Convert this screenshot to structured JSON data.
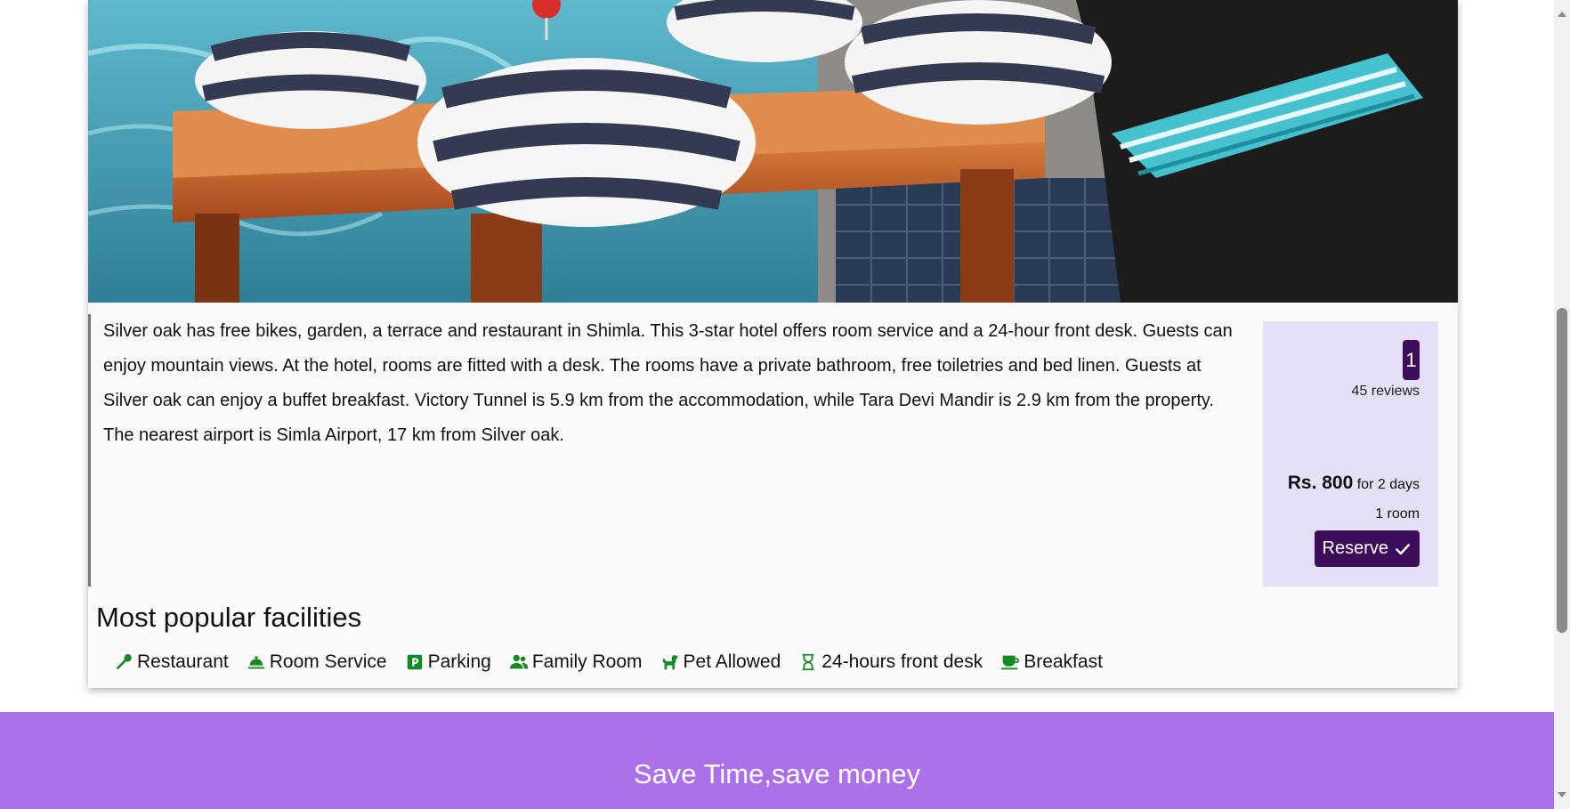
{
  "hotel": {
    "description": "Silver oak has free bikes, garden, a terrace and restaurant in Shimla. This 3-star hotel offers room service and a 24-hour front desk. Guests can enjoy mountain views. At the hotel, rooms are fitted with a desk. The rooms have a private bathroom, free toiletries and bed linen. Guests at Silver oak can enjoy a buffet breakfast. Victory Tunnel is 5.9 km from the accommodation, while Tara Devi Mandir is 2.9 km from the property. The nearest airport is Simla Airport, 17 km from Silver oak.",
    "score": "1",
    "reviews": "45 reviews",
    "price": "Rs. 800",
    "price_period": "for 2 days",
    "rooms": "1 room",
    "reserve_label": "Reserve"
  },
  "facilities": {
    "title": "Most popular facilities",
    "items": [
      {
        "label": "Restaurant",
        "icon": "utensil-icon"
      },
      {
        "label": "Room Service",
        "icon": "service-bell-icon"
      },
      {
        "label": "Parking",
        "icon": "parking-icon"
      },
      {
        "label": "Family Room",
        "icon": "users-icon"
      },
      {
        "label": "Pet Allowed",
        "icon": "dog-icon"
      },
      {
        "label": "24-hours front desk",
        "icon": "hourglass-icon"
      },
      {
        "label": "Breakfast",
        "icon": "coffee-icon"
      }
    ]
  },
  "footer": {
    "title": "Save Time,save money"
  },
  "colors": {
    "accent": "#3d0d5c",
    "side_panel": "#e5e0f7",
    "facility_icon": "#138a22",
    "footer_band": "#ac71e8"
  }
}
